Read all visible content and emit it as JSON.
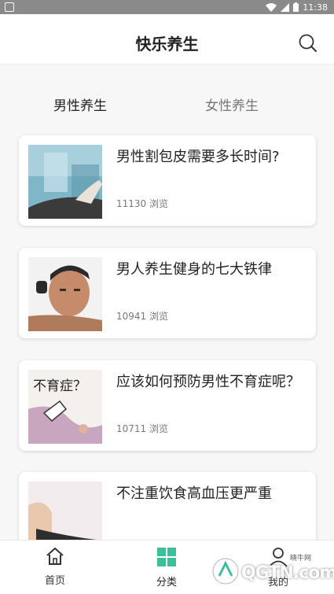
{
  "status_bar": {
    "time": "11:38"
  },
  "header": {
    "title": "快乐养生"
  },
  "tabs": [
    {
      "label": "男性养生",
      "active": true
    },
    {
      "label": "女性养生",
      "active": false
    }
  ],
  "articles": [
    {
      "title": "男性割包皮需要多长时间?",
      "views": "11130 浏览",
      "thumb": "hospital-icon"
    },
    {
      "title": "男人养生健身的七大铁律",
      "views": "10941 浏览",
      "thumb": "man-photo"
    },
    {
      "title": "应该如何预防男性不育症呢？",
      "views": "10711 浏览",
      "thumb": "cartoon",
      "thumb_text": "不育症？"
    },
    {
      "title": "不注重饮食高血压更严重",
      "views": "",
      "thumb": "bp-photo"
    }
  ],
  "bottom_nav": [
    {
      "label": "首页",
      "icon": "home-icon"
    },
    {
      "label": "分类",
      "icon": "grid-icon",
      "active": true
    },
    {
      "label": "我的",
      "icon": "user-icon"
    }
  ],
  "watermark": {
    "text": "QGTN.com",
    "small": "晓牛网"
  },
  "colors": {
    "accent": "#3dbf9a"
  }
}
